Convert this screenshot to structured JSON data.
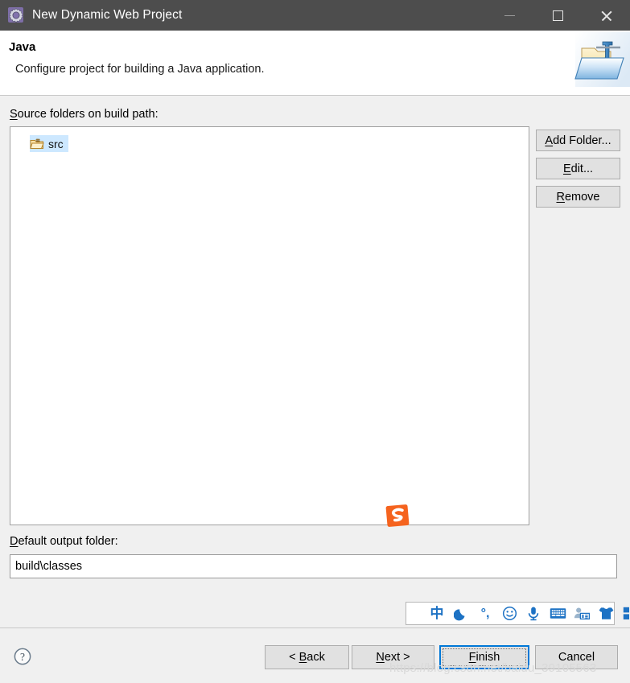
{
  "window": {
    "title": "New Dynamic Web Project",
    "icon": "eclipse-wizard-gear-icon",
    "controls": {
      "minimize": "minimize-icon",
      "maximize": "maximize-icon",
      "close": "close-icon"
    }
  },
  "header": {
    "title": "Java",
    "description": "Configure project for building a Java application.",
    "banner_icon": "java-folder-icon"
  },
  "main": {
    "source_label_accel": "S",
    "source_label_rest": "ource folders on build path:",
    "source_items": [
      {
        "label": "src",
        "icon": "package-folder-icon",
        "selected": true
      }
    ],
    "output_label_accel": "D",
    "output_label_rest": "efault output folder:",
    "output_value": "build\\classes",
    "output_placeholder": "",
    "side_buttons": [
      {
        "accel": "A",
        "rest": "dd Folder...",
        "name": "add-folder-button"
      },
      {
        "accel": "E",
        "rest": "dit...",
        "name": "edit-button"
      },
      {
        "accel": "R",
        "rest": "emove",
        "name": "remove-button"
      }
    ]
  },
  "footer": {
    "help_icon": "help-question-icon",
    "buttons": [
      {
        "pre": "< ",
        "accel": "B",
        "rest": "ack",
        "name": "back-button",
        "default": false
      },
      {
        "pre": "",
        "accel": "N",
        "rest": "ext >",
        "name": "next-button",
        "default": false
      },
      {
        "pre": "",
        "accel": "F",
        "rest": "inish",
        "name": "finish-button",
        "default": true
      },
      {
        "pre": "",
        "accel": "",
        "rest": "Cancel",
        "name": "cancel-button",
        "default": false
      }
    ]
  },
  "watermark": "https://blog.csdn.net/baidu_39105563",
  "ime_toolbar": {
    "logo": "sogou-logo-icon",
    "items": [
      {
        "name": "chinese-mode-icon",
        "glyph": "中"
      },
      {
        "name": "moon-icon",
        "glyph": ""
      },
      {
        "name": "punctuation-mode-icon",
        "glyph": "°,"
      },
      {
        "name": "emoji-icon",
        "glyph": ""
      },
      {
        "name": "microphone-icon",
        "glyph": ""
      },
      {
        "name": "soft-keyboard-icon",
        "glyph": ""
      },
      {
        "name": "user-card-icon",
        "glyph": ""
      },
      {
        "name": "skin-shirt-icon",
        "glyph": ""
      },
      {
        "name": "toolbox-grid-icon",
        "glyph": ""
      }
    ]
  },
  "colors": {
    "titlebar": "#4d4d4d",
    "accent": "#0078d7",
    "selection": "#cde8ff",
    "body": "#f0f0f0",
    "ime_blue": "#1d72c4",
    "ime_orange": "#f5631e"
  }
}
